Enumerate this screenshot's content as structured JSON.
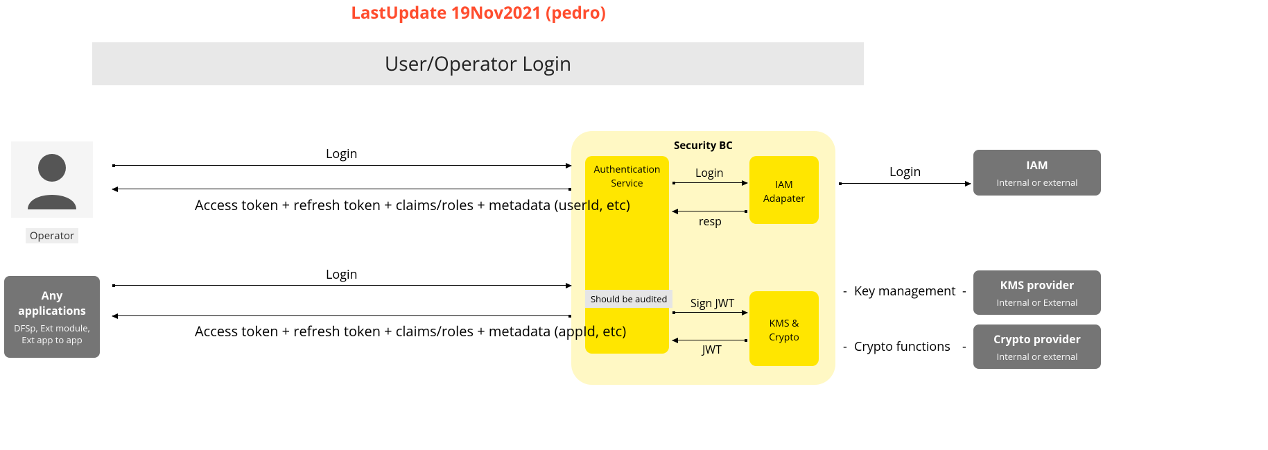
{
  "header": {
    "update": "LastUpdate 19Nov2021 (pedro)"
  },
  "title": "User/Operator Login",
  "actors": {
    "operator": {
      "label": "Operator"
    },
    "apps": {
      "title": "Any applications",
      "subtitle": "DFSp, Ext module, Ext app to app"
    }
  },
  "security_bc": {
    "title": "Security BC",
    "auth_service": "Authentication Service",
    "iam_adapter": "IAM Adapater",
    "kms_crypto": "KMS & Crypto",
    "audit_note": "Should be audited"
  },
  "external": {
    "iam": {
      "title": "IAM",
      "subtitle": "Internal or external"
    },
    "kms": {
      "title": "KMS provider",
      "subtitle": "Internal or External"
    },
    "crypto": {
      "title": "Crypto provider",
      "subtitle": "Internal or external"
    }
  },
  "arrows": {
    "op_login": "Login",
    "op_resp": "Access token + refresh token + claims/roles + metadata (userId, etc)",
    "app_login": "Login",
    "app_resp": "Access token + refresh token + claims/roles + metadata (appId, etc)",
    "auth_iam_login": "Login",
    "auth_iam_resp": "resp",
    "auth_kms_sign": "Sign JWT",
    "auth_kms_resp": "JWT",
    "secbc_iam": "Login",
    "key_mgmt": "Key management",
    "crypto_fn": "Crypto functions"
  }
}
